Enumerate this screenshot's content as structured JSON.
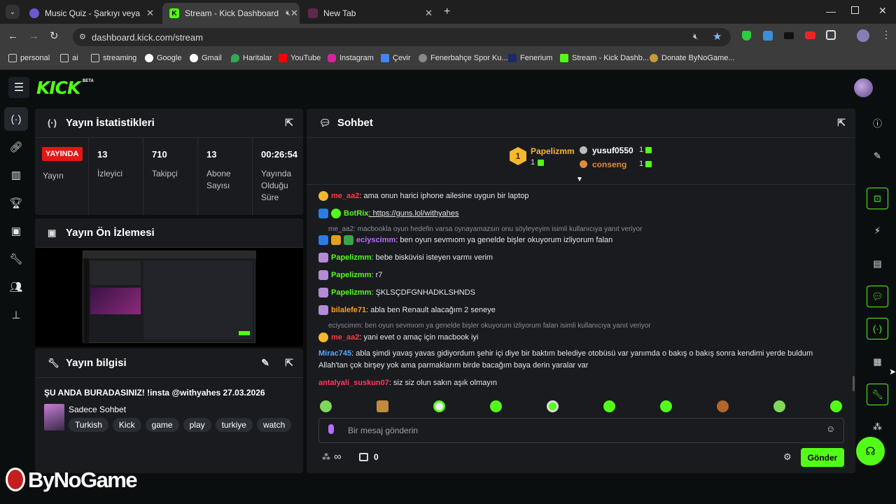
{
  "browser": {
    "tabs": [
      {
        "title": "Music Quiz - Şarkıyı veya sanatç"
      },
      {
        "title": "Stream - Kick Dashboard"
      },
      {
        "title": "New Tab"
      }
    ],
    "url": "dashboard.kick.com/stream",
    "bookmarks": [
      "personal",
      "ai",
      "streaming",
      "Google",
      "Gmail",
      "Haritalar",
      "YouTube",
      "Instagram",
      "Çevir",
      "Fenerbahçe Spor Ku...",
      "Fenerium",
      "Stream - Kick Dashb...",
      "Donate ByNoGame..."
    ]
  },
  "brand": {
    "logo": "KICK",
    "beta": "BETA",
    "accent": "#53fc18"
  },
  "stats": {
    "title": "Yayın İstatistikleri",
    "live_badge": "YAYINDA",
    "live_label": "Yayın",
    "items": [
      {
        "value": "13",
        "label": "İzleyici"
      },
      {
        "value": "710",
        "label": "Takipçi"
      },
      {
        "value": "13",
        "label": "Abone Sayısı"
      },
      {
        "value": "00:26:54",
        "label": "Yayında Olduğu Süre"
      }
    ]
  },
  "preview": {
    "title": "Yayın Ön İzlemesi"
  },
  "info": {
    "title": "Yayın bilgisi",
    "stream_title": "ŞU ANDA BURADASINIZ! !insta @withyahes 27.03.2026",
    "category": "Sadece Sohbet",
    "tags": [
      "Turkish",
      "Kick",
      "game",
      "play",
      "turkiye",
      "watch"
    ]
  },
  "chat": {
    "title": "Sohbet",
    "leaderboard": {
      "first": {
        "name": "Papelizmm",
        "count": "1",
        "rank": "1"
      },
      "second": {
        "name": "yusuf0550",
        "count": "1"
      },
      "third": {
        "name": "conseng",
        "count": "1"
      }
    },
    "messages": [
      {
        "user": "me_aa2",
        "text": ": ama onun harici iphone ailesine uygun bir laptop",
        "color": "#ff3b3b"
      },
      {
        "user": "BotRix",
        "text": ": https://guns.lol/withyahes",
        "color": "#53fc18"
      },
      {
        "reply": "me_aa2: macbookla oyun hedefin varsa oynayamazsın onu söyleyeyim isimli kullanıcıya yanıt veriyor"
      },
      {
        "user": "eciyscimm",
        "text": ": ben oyun sevmıom ya genelde bişler okuyorum izliyorum falan",
        "color": "#b86bff"
      },
      {
        "user": "Papelizmm",
        "text": ": bebe bisküvisi isteyen varmı verim",
        "color": "#53fc18"
      },
      {
        "user": "Papelizmm",
        "text": ": r7",
        "color": "#53fc18"
      },
      {
        "user": "Papelizmm",
        "text": ": ŞKLSÇDFGNHADKLSHNDS",
        "color": "#53fc18"
      },
      {
        "user": "bilalefe71",
        "text": ": abla ben Renault alacağım 2 seneye",
        "color": "#ff9f1a"
      },
      {
        "reply": "eciyscimm: ben oyun sevmıom ya genelde bişler okuyorum izliyorum falan isimli kullanıcıya yanıt veriyor"
      },
      {
        "user": "me_aa2",
        "text": ": yani evet o amaç için macbook iyi",
        "color": "#ff3b3b"
      },
      {
        "user": "Mirac745",
        "text": ": abla şimdi yavaş yavas gidiyordum şehir içi diye bir baktım belediye otobüsü var yanımda o bakış o bakış sonra kendimi yerde buldum",
        "color": "#5aa9ff"
      },
      {
        "cont": "Allah'tan çok birşey yok ama parmaklarım birde bacağım baya derin yaralar var"
      },
      {
        "user": "antalyali_suskun07",
        "text": ": siz siz olun sakın aşık olmayın",
        "color": "#ff3b5c"
      }
    ],
    "input_placeholder": "Bir mesaj gönderin",
    "points": "∞",
    "store_count": "0",
    "send_label": "Gönder"
  },
  "watermark": "ByNoGame"
}
